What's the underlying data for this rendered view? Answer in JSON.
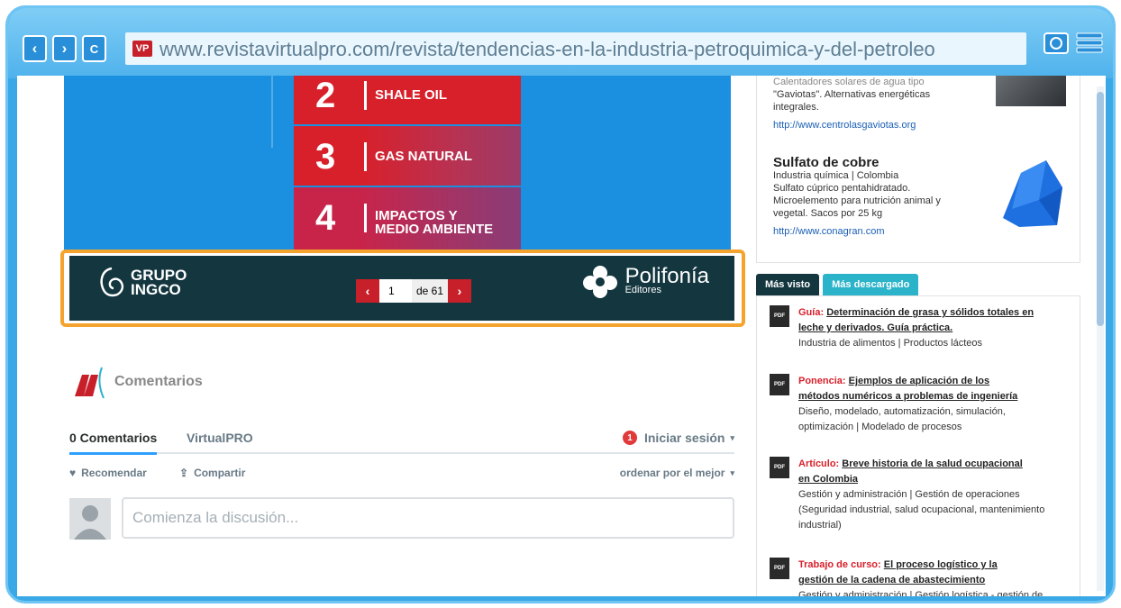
{
  "browser": {
    "back_label": "‹",
    "forward_label": "›",
    "reload_label": "C",
    "favicon_text": "VP",
    "url": "www.revistavirtualpro.com/revista/tendencias-en-la-industria-petroquimica-y-del-petroleo"
  },
  "hero": {
    "topics": [
      {
        "num": "2",
        "label": "SHALE OIL"
      },
      {
        "num": "3",
        "label": "GAS NATURAL"
      },
      {
        "num": "4",
        "label_line1": "IMPACTOS Y",
        "label_line2": "MEDIO AMBIENTE"
      }
    ]
  },
  "pager_bar": {
    "left_logo_line1": "GRUPO",
    "left_logo_line2": "INGCO",
    "page_value": "1",
    "page_of": "de 61",
    "right_logo_name": "Polifonía",
    "right_logo_sub": "Editores"
  },
  "comments": {
    "title": "Comentarios",
    "tab_count": "0 Comentarios",
    "tab_site": "VirtualPRO",
    "login": "Iniciar sesión",
    "login_badge": "1",
    "recommend": "Recomendar",
    "share": "Compartir",
    "sort": "ordenar por el mejor",
    "placeholder": "Comienza la discusión..."
  },
  "sidebar": {
    "top_product": {
      "desc_line1": "Calentadores solares de agua tipo",
      "desc_line2": "\"Gaviotas\". Alternativas energéticas",
      "desc_line3": "integrales.",
      "link": "http://www.centrolasgaviotas.org"
    },
    "product": {
      "title": "Sulfato de cobre",
      "meta": "Industria química | Colombia",
      "desc_line1": "Sulfato cúprico pentahidratado.",
      "desc_line2": "Microelemento para nutrición animal y",
      "desc_line3": "vegetal. Sacos por 25 kg",
      "link": "http://www.conagran.com"
    },
    "tabs": [
      "Más visto",
      "Más descargado"
    ],
    "items": [
      {
        "kind": "Guía:",
        "title_line1": "Determinación de grasa y sólidos totales en",
        "title_line2": "leche y derivados. Guía práctica.",
        "meta_line1": "Industria de alimentos | Productos lácteos"
      },
      {
        "kind": "Ponencia:",
        "title_line1": "Ejemplos de aplicación de los",
        "title_line2": "métodos numéricos a problemas de ingeniería",
        "meta_line1": "Diseño, modelado, automatización, simulación,",
        "meta_line2": "optimización | Modelado de procesos"
      },
      {
        "kind": "Artículo:",
        "title_line1": "Breve historia de la salud ocupacional",
        "title_line2": "en Colombia",
        "meta_line1": "Gestión y administración | Gestión de operaciones",
        "meta_line2": "(Seguridad industrial, salud ocupacional, mantenimiento",
        "meta_line3": "industrial)"
      },
      {
        "kind": "Trabajo de curso:",
        "title_line1": "El proceso logístico y la",
        "title_line2": "gestión de la cadena de abastecimiento",
        "meta_line1": "Gestión y administración | Gestión logística - gestión de"
      }
    ],
    "pdf_label": "PDF"
  },
  "colors": {
    "frame": "#3aa7e6",
    "accent_red": "#d8202b",
    "highlight": "#f4a42e",
    "dark_teal": "#13363f"
  }
}
